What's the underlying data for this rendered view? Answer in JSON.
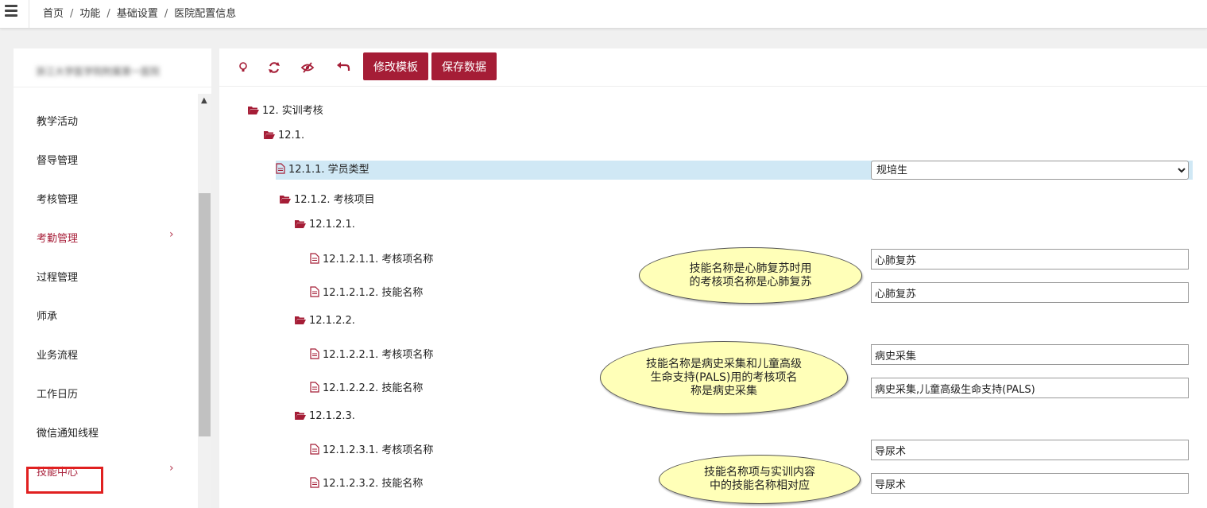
{
  "breadcrumb": [
    "首页",
    "功能",
    "基础设置",
    "医院配置信息"
  ],
  "sidebar": {
    "hospital_name": "浙江大学医学院附属第一医院",
    "items": [
      {
        "label": "教学活动",
        "has_submenu": false
      },
      {
        "label": "督导管理",
        "has_submenu": false
      },
      {
        "label": "考核管理",
        "has_submenu": false
      },
      {
        "label": "考勤管理",
        "has_submenu": true
      },
      {
        "label": "过程管理",
        "has_submenu": false
      },
      {
        "label": "师承",
        "has_submenu": false
      },
      {
        "label": "业务流程",
        "has_submenu": false
      },
      {
        "label": "工作日历",
        "has_submenu": false
      },
      {
        "label": "微信通知线程",
        "has_submenu": false
      },
      {
        "label": "技能中心",
        "has_submenu": true
      }
    ]
  },
  "toolbar": {
    "icons": [
      "bulb-icon",
      "refresh-icon",
      "eye-slash-icon",
      "undo-icon"
    ],
    "edit_template_label": "修改模板",
    "save_data_label": "保存数据"
  },
  "tree": {
    "n12": "12. 实训考核",
    "n12_1": "12.1.",
    "n12_1_1": "12.1.1. 学员类型",
    "n12_1_2": "12.1.2. 考核项目",
    "n12_1_2_1": "12.1.2.1.",
    "n12_1_2_1_1": "12.1.2.1.1. 考核项名称",
    "n12_1_2_1_2": "12.1.2.1.2. 技能名称",
    "n12_1_2_2": "12.1.2.2.",
    "n12_1_2_2_1": "12.1.2.2.1. 考核项名称",
    "n12_1_2_2_2": "12.1.2.2.2. 技能名称",
    "n12_1_2_3": "12.1.2.3.",
    "n12_1_2_3_1": "12.1.2.3.1. 考核项名称",
    "n12_1_2_3_2": "12.1.2.3.2. 技能名称"
  },
  "fields": {
    "student_type_selected": "规培生",
    "f1_item": "心肺复苏",
    "f1_skill": "心肺复苏",
    "f2_item": "病史采集",
    "f2_skill": "病史采集,儿童高级生命支持(PALS)",
    "f3_item": "导尿术",
    "f3_skill": "导尿术"
  },
  "callouts": {
    "c1_line1": "技能名称是心肺复苏时用",
    "c1_line2": "的考核项名称是心肺复苏",
    "c2_line1": "技能名称是病史采集和儿童高级",
    "c2_line2": "生命支持(PALS)用的考核项名",
    "c2_line3": "称是病史采集",
    "c3_line1": "技能名称项与实训内容",
    "c3_line2": "中的技能名称相对应"
  },
  "colors": {
    "accent": "#a51d36",
    "menu_active": "#a8203a",
    "selected_row": "#d0e8f5",
    "callout_fill": "#ffffb8",
    "highlight": "#e02020"
  }
}
